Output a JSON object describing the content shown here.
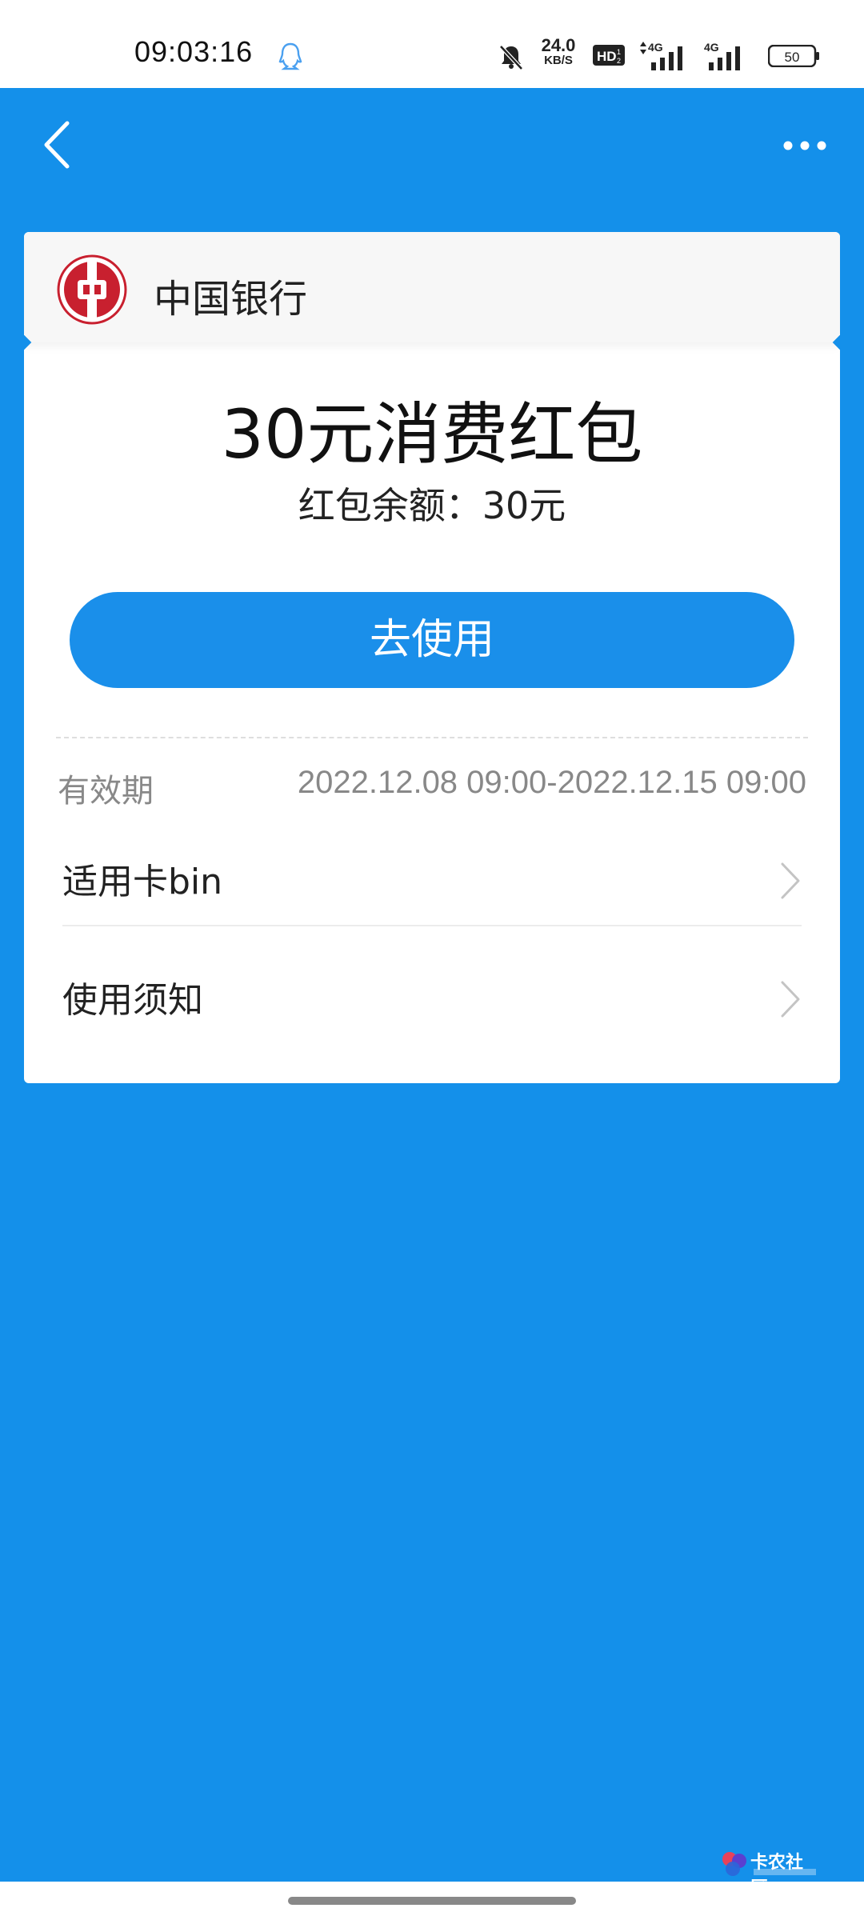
{
  "status_bar": {
    "time": "09:03:16",
    "net_speed_value": "24.0",
    "net_speed_unit": "KB/S",
    "hd_label": "HD",
    "signal_1_label": "4G",
    "signal_2_label": "4G",
    "battery_level": "50"
  },
  "header": {
    "back_icon": "chevron-left-icon",
    "more_icon": "more-dots-icon"
  },
  "card": {
    "bank_name": "中国银行",
    "bank_logo": "boc-logo",
    "coupon_title": "30元消费红包",
    "coupon_balance": "红包余额：30元",
    "use_button_label": "去使用",
    "validity_label": "有效期",
    "validity_value": "2022.12.08 09:00-2022.12.15 09:00",
    "rows": [
      {
        "label": "适用卡bin"
      },
      {
        "label": "使用须知"
      }
    ]
  },
  "watermark": {
    "text": "卡农社区"
  },
  "colors": {
    "background": "#1490ea",
    "button": "#1a8fea",
    "bank_red": "#c8202f"
  }
}
